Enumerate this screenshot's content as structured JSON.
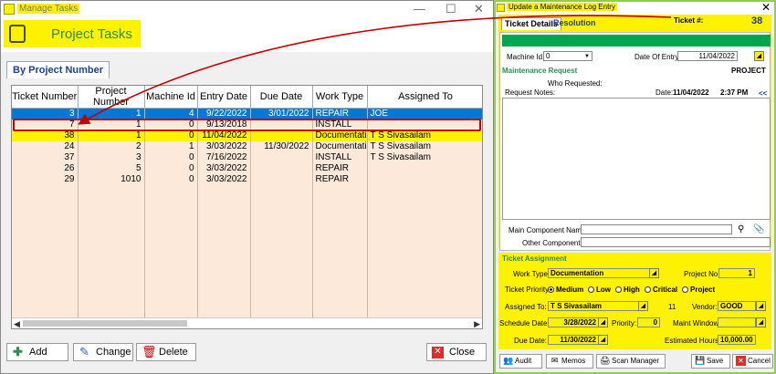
{
  "left": {
    "title": "Manage Tasks",
    "header_title": "Project Tasks",
    "tab": "By Project Number",
    "columns": [
      "Ticket Number",
      "Project Number",
      "Machine Id",
      "Entry Date",
      "Due Date",
      "Work Type",
      "Assigned To"
    ],
    "rows": [
      [
        "3",
        "1",
        "4",
        "9/22/2022",
        "3/01/2022",
        "REPAIR",
        "JOE"
      ],
      [
        "7",
        "1",
        "0",
        "9/13/2018",
        "",
        "INSTALL",
        ""
      ],
      [
        "38",
        "1",
        "0",
        "11/04/2022",
        "",
        "Documentatio",
        "T S Sivasailam"
      ],
      [
        "24",
        "2",
        "1",
        "3/03/2022",
        "11/30/2022",
        "Documentatio",
        "T S Sivasailam"
      ],
      [
        "37",
        "3",
        "0",
        "7/16/2022",
        "",
        "INSTALL",
        "T S Sivasailam"
      ],
      [
        "26",
        "5",
        "0",
        "3/03/2022",
        "",
        "REPAIR",
        ""
      ],
      [
        "29",
        "1010",
        "0",
        "3/03/2022",
        "",
        "REPAIR",
        ""
      ]
    ],
    "buttons": {
      "add": "Add",
      "change": "Change",
      "delete": "Delete",
      "close": "Close"
    }
  },
  "right": {
    "title": "Update a Maintenance Log Entry",
    "ticket_label": "Ticket #:",
    "ticket_no": "38",
    "tabs": [
      "Ticket Details",
      "Resolution"
    ],
    "machine_id_label": "Machine Id:",
    "machine_id": "0",
    "date_entry_label": "Date Of Entry:",
    "date_entry": "11/04/2022",
    "maint_request": "Maintenance Request",
    "project_label": "PROJECT",
    "who_requested": "Who Requested:",
    "request_notes": "Request Notes:",
    "date_label": "Date:",
    "date_value": "11/04/2022",
    "time_value": "2:37 PM",
    "collapse": "<<",
    "main_component": "Main Component Name:",
    "other_components": "Other Components:",
    "ticket_assignment": "Ticket Assignment",
    "work_type_label": "Work Type:",
    "work_type": "Documentation",
    "project_no_label": "Project No:",
    "project_no": "1",
    "priority_label": "Ticket Priority:",
    "priorities": [
      "Medium",
      "Low",
      "High",
      "Critical",
      "Project"
    ],
    "assigned_label": "Assigned To:",
    "assigned": "T S Sivasailam",
    "assigned_code": "11",
    "vendor_label": "Vendor:",
    "vendor": "GOOD",
    "schedule_label": "Schedule Date:",
    "schedule_date": "3/28/2022",
    "priority_num_label": "Priority:",
    "priority_num": "0",
    "maint_window_label": "Maint Window:",
    "due_label": "Due Date:",
    "due_date": "11/30/2022",
    "est_hours_label": "Estimated Hours:",
    "est_hours": "10,000.00",
    "buttons": {
      "audit": "Audit",
      "memos": "Memos",
      "scan": "Scan Manager",
      "save": "Save",
      "cancel": "Cancel"
    }
  },
  "colors": {
    "highlight": "#fff200",
    "selected": "#0078d7",
    "annotation": "#c00000",
    "green": "#00a650"
  }
}
